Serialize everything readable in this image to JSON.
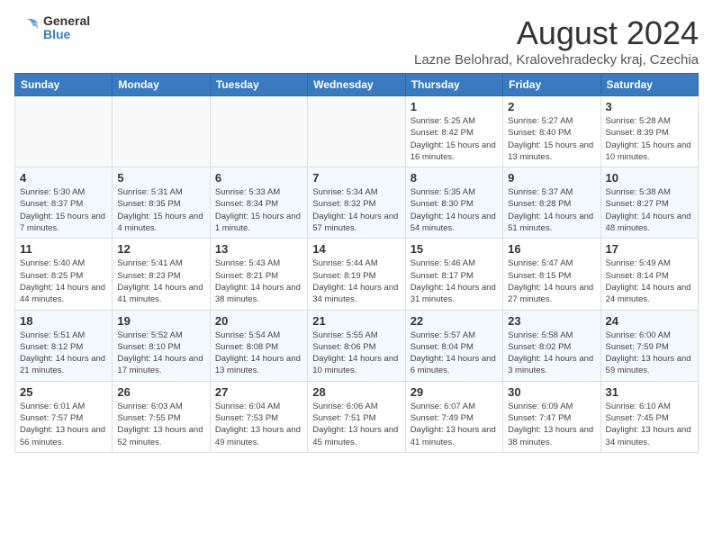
{
  "logo": {
    "general": "General",
    "blue": "Blue"
  },
  "title": "August 2024",
  "subtitle": "Lazne Belohrad, Kralovehradecky kraj, Czechia",
  "headers": [
    "Sunday",
    "Monday",
    "Tuesday",
    "Wednesday",
    "Thursday",
    "Friday",
    "Saturday"
  ],
  "weeks": [
    [
      {
        "day": "",
        "info": ""
      },
      {
        "day": "",
        "info": ""
      },
      {
        "day": "",
        "info": ""
      },
      {
        "day": "",
        "info": ""
      },
      {
        "day": "1",
        "info": "Sunrise: 5:25 AM\nSunset: 8:42 PM\nDaylight: 15 hours\nand 16 minutes."
      },
      {
        "day": "2",
        "info": "Sunrise: 5:27 AM\nSunset: 8:40 PM\nDaylight: 15 hours\nand 13 minutes."
      },
      {
        "day": "3",
        "info": "Sunrise: 5:28 AM\nSunset: 8:39 PM\nDaylight: 15 hours\nand 10 minutes."
      }
    ],
    [
      {
        "day": "4",
        "info": "Sunrise: 5:30 AM\nSunset: 8:37 PM\nDaylight: 15 hours\nand 7 minutes."
      },
      {
        "day": "5",
        "info": "Sunrise: 5:31 AM\nSunset: 8:35 PM\nDaylight: 15 hours\nand 4 minutes."
      },
      {
        "day": "6",
        "info": "Sunrise: 5:33 AM\nSunset: 8:34 PM\nDaylight: 15 hours\nand 1 minute."
      },
      {
        "day": "7",
        "info": "Sunrise: 5:34 AM\nSunset: 8:32 PM\nDaylight: 14 hours\nand 57 minutes."
      },
      {
        "day": "8",
        "info": "Sunrise: 5:35 AM\nSunset: 8:30 PM\nDaylight: 14 hours\nand 54 minutes."
      },
      {
        "day": "9",
        "info": "Sunrise: 5:37 AM\nSunset: 8:28 PM\nDaylight: 14 hours\nand 51 minutes."
      },
      {
        "day": "10",
        "info": "Sunrise: 5:38 AM\nSunset: 8:27 PM\nDaylight: 14 hours\nand 48 minutes."
      }
    ],
    [
      {
        "day": "11",
        "info": "Sunrise: 5:40 AM\nSunset: 8:25 PM\nDaylight: 14 hours\nand 44 minutes."
      },
      {
        "day": "12",
        "info": "Sunrise: 5:41 AM\nSunset: 8:23 PM\nDaylight: 14 hours\nand 41 minutes."
      },
      {
        "day": "13",
        "info": "Sunrise: 5:43 AM\nSunset: 8:21 PM\nDaylight: 14 hours\nand 38 minutes."
      },
      {
        "day": "14",
        "info": "Sunrise: 5:44 AM\nSunset: 8:19 PM\nDaylight: 14 hours\nand 34 minutes."
      },
      {
        "day": "15",
        "info": "Sunrise: 5:46 AM\nSunset: 8:17 PM\nDaylight: 14 hours\nand 31 minutes."
      },
      {
        "day": "16",
        "info": "Sunrise: 5:47 AM\nSunset: 8:15 PM\nDaylight: 14 hours\nand 27 minutes."
      },
      {
        "day": "17",
        "info": "Sunrise: 5:49 AM\nSunset: 8:14 PM\nDaylight: 14 hours\nand 24 minutes."
      }
    ],
    [
      {
        "day": "18",
        "info": "Sunrise: 5:51 AM\nSunset: 8:12 PM\nDaylight: 14 hours\nand 21 minutes."
      },
      {
        "day": "19",
        "info": "Sunrise: 5:52 AM\nSunset: 8:10 PM\nDaylight: 14 hours\nand 17 minutes."
      },
      {
        "day": "20",
        "info": "Sunrise: 5:54 AM\nSunset: 8:08 PM\nDaylight: 14 hours\nand 13 minutes."
      },
      {
        "day": "21",
        "info": "Sunrise: 5:55 AM\nSunset: 8:06 PM\nDaylight: 14 hours\nand 10 minutes."
      },
      {
        "day": "22",
        "info": "Sunrise: 5:57 AM\nSunset: 8:04 PM\nDaylight: 14 hours\nand 6 minutes."
      },
      {
        "day": "23",
        "info": "Sunrise: 5:58 AM\nSunset: 8:02 PM\nDaylight: 14 hours\nand 3 minutes."
      },
      {
        "day": "24",
        "info": "Sunrise: 6:00 AM\nSunset: 7:59 PM\nDaylight: 13 hours\nand 59 minutes."
      }
    ],
    [
      {
        "day": "25",
        "info": "Sunrise: 6:01 AM\nSunset: 7:57 PM\nDaylight: 13 hours\nand 56 minutes."
      },
      {
        "day": "26",
        "info": "Sunrise: 6:03 AM\nSunset: 7:55 PM\nDaylight: 13 hours\nand 52 minutes."
      },
      {
        "day": "27",
        "info": "Sunrise: 6:04 AM\nSunset: 7:53 PM\nDaylight: 13 hours\nand 49 minutes."
      },
      {
        "day": "28",
        "info": "Sunrise: 6:06 AM\nSunset: 7:51 PM\nDaylight: 13 hours\nand 45 minutes."
      },
      {
        "day": "29",
        "info": "Sunrise: 6:07 AM\nSunset: 7:49 PM\nDaylight: 13 hours\nand 41 minutes."
      },
      {
        "day": "30",
        "info": "Sunrise: 6:09 AM\nSunset: 7:47 PM\nDaylight: 13 hours\nand 38 minutes."
      },
      {
        "day": "31",
        "info": "Sunrise: 6:10 AM\nSunset: 7:45 PM\nDaylight: 13 hours\nand 34 minutes."
      }
    ]
  ]
}
